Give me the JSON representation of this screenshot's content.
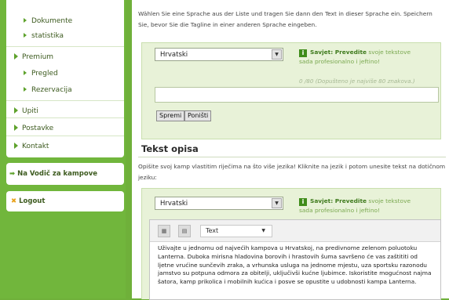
{
  "sidebar": {
    "items": [
      {
        "label": "Dokumente",
        "sub": true
      },
      {
        "label": "statistika",
        "sub": true
      },
      {
        "label": "Premium",
        "sub": false
      },
      {
        "label": "Pregled",
        "sub": true
      },
      {
        "label": "Rezervacija",
        "sub": true
      },
      {
        "label": "Upiti",
        "sub": false
      },
      {
        "label": "Postavke",
        "sub": false
      },
      {
        "label": "Kontakt",
        "sub": false
      }
    ],
    "vodic_label": "Na Vodič za kampove",
    "logout_label": "Logout"
  },
  "tagline": {
    "intro": "Wählen Sie eine Sprache aus der Liste und tragen Sie dann den Text in dieser Sprache ein. Speichern Sie, bevor Sie die Tagline in einer anderen Sprache eingeben.",
    "language": "Hrvatski",
    "tip_title": "Savjet: Prevedite",
    "tip_text": "svoje tekstove sada profesionalno i jeftino!",
    "counter": "0 /80 (Dopušteno je najviše 80 znakova.)",
    "input_value": "",
    "save_label": "Spremi",
    "cancel_label": "Poništi"
  },
  "description": {
    "title": "Tekst opisa",
    "intro": "Opišite svoj kamp vlastitim riječima na što više jezika! Kliknite na jezik i potom unesite tekst na dotičnom jeziku:",
    "language": "Hrvatski",
    "tip_title": "Savjet: Prevedite",
    "tip_text": "svoje tekstove sada profesionalno i jeftino!",
    "format_select": "Text",
    "body": "Uživajte u jednomu od najvećih kampova u Hrvatskoj, na predivnome zelenom poluotoku Lanterna. Duboka mirisna hladovina borovih i hrastovih šuma savršeno će vas zaštititi od ljetne vrućine sunčevih zraka, a vrhunska usluga na jednome mjestu, uza sportsku razonodu jamstvo su potpuna odmora za obitelji, uključivši kućne ljubimce. Iskoristite mogućnost najma šatora, kamp prikolica i mobilnih kućica i posve se opustite u udobnosti kampa Lanterna."
  }
}
